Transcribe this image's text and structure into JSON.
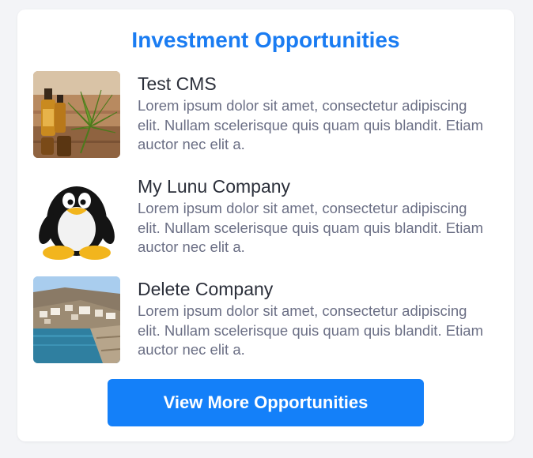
{
  "widget": {
    "title": "Investment Opportunities",
    "items": [
      {
        "name": "Test CMS",
        "description": "Lorem ipsum dolor sit amet, consectetur adipiscing elit. Nullam scelerisque quis quam quis blandit. Etiam auctor nec elit a.",
        "image": "cannabis-oil-image"
      },
      {
        "name": "My Lunu Company",
        "description": "Lorem ipsum dolor sit amet, consectetur adipiscing elit. Nullam scelerisque quis quam quis blandit. Etiam auctor nec elit a.",
        "image": "penguin-image"
      },
      {
        "name": "Delete Company",
        "description": "Lorem ipsum dolor sit amet, consectetur adipiscing elit. Nullam scelerisque quis quam quis blandit. Etiam auctor nec elit a.",
        "image": "coastal-village-image"
      }
    ],
    "button_label": "View More Opportunities"
  },
  "colors": {
    "accent": "#1a7cf2",
    "button": "#1480f9",
    "title_text": "#2b2f3a",
    "body_text": "#6b6f85"
  }
}
